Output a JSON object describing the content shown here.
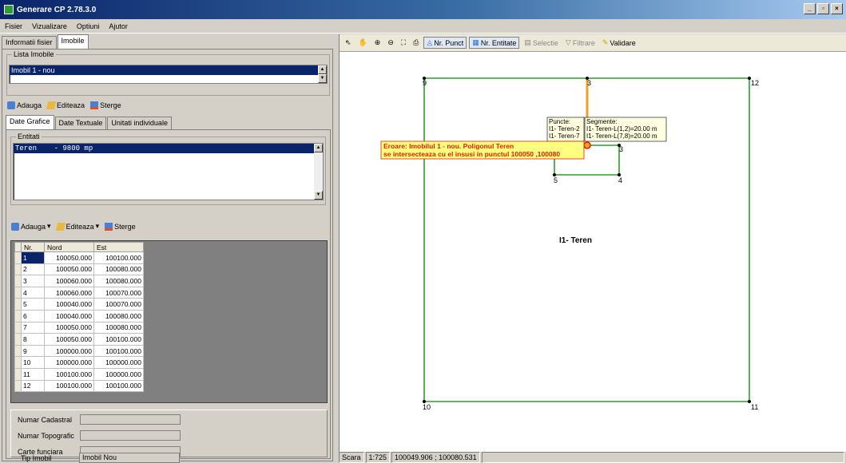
{
  "window": {
    "title": "Generare CP 2.78.3.0"
  },
  "menu": [
    "Fisier",
    "Vizualizare",
    "Optiuni",
    "Ajutor"
  ],
  "main_tabs": [
    "Informatii fisier",
    "Imobile"
  ],
  "imobile": {
    "group_label": "Lista Imobile",
    "selected": "Imobil 1 - nou",
    "buttons": [
      "Adauga",
      "Editeaza",
      "Sterge"
    ]
  },
  "sub_tabs": [
    "Date Grafice",
    "Date Textuale",
    "Unitati individuale"
  ],
  "entitati": {
    "group_label": "Entitati",
    "selected": "Teren    - 9800 mp",
    "buttons": [
      "Adauga",
      "Editeaza",
      "Sterge"
    ]
  },
  "table": {
    "headers": [
      "Nr.",
      "Nord",
      "Est"
    ],
    "rows": [
      [
        "1",
        "100050.000",
        "100100.000"
      ],
      [
        "2",
        "100050.000",
        "100080.000"
      ],
      [
        "3",
        "100060.000",
        "100080.000"
      ],
      [
        "4",
        "100060.000",
        "100070.000"
      ],
      [
        "5",
        "100040.000",
        "100070.000"
      ],
      [
        "6",
        "100040.000",
        "100080.000"
      ],
      [
        "7",
        "100050.000",
        "100080.000"
      ],
      [
        "8",
        "100050.000",
        "100100.000"
      ],
      [
        "9",
        "100000.000",
        "100100.000"
      ],
      [
        "10",
        "100000.000",
        "100000.000"
      ],
      [
        "11",
        "100100.000",
        "100000.000"
      ],
      [
        "12",
        "100100.000",
        "100100.000"
      ]
    ]
  },
  "fields": [
    {
      "label": "Numar Cadastral",
      "value": ""
    },
    {
      "label": "Numar Topografic",
      "value": ""
    },
    {
      "label": "Carte funciara",
      "value": ""
    },
    {
      "label": "Tip Imobil",
      "value": "Imobil Nou"
    }
  ],
  "toolbar": {
    "nr_punct": "Nr. Punct",
    "nr_entitate": "Nr. Entitate",
    "selectie": "Selectie",
    "filtrare": "Filtrare",
    "validare": "Validare"
  },
  "canvas": {
    "point_labels": [
      "9",
      "3",
      "12",
      "3",
      "5",
      "4",
      "10",
      "11"
    ],
    "area_label": "I1- Teren",
    "tooltip_puncte": [
      "Puncte:",
      "I1- Teren-2",
      "I1- Teren-7"
    ],
    "tooltip_segmente": [
      "Segmente:",
      "I1- Teren-L(1,2)=20.00 m",
      "I1- Teren-L(7,8)=20.00 m"
    ],
    "error_lines": [
      "Eroare: Imobilul 1 - nou. Poligonul Teren",
      "se intersecteaza cu el insusi in punctul 100050 ,100080"
    ]
  },
  "status": {
    "label": "Scara",
    "scale": "1:725",
    "coords": "100049.906 ; 100080.531"
  },
  "colors": {
    "polygon": "#2e9e2e",
    "highlight": "#f0a020",
    "error_bg": "#ffff80",
    "error_text": "#e02000"
  }
}
